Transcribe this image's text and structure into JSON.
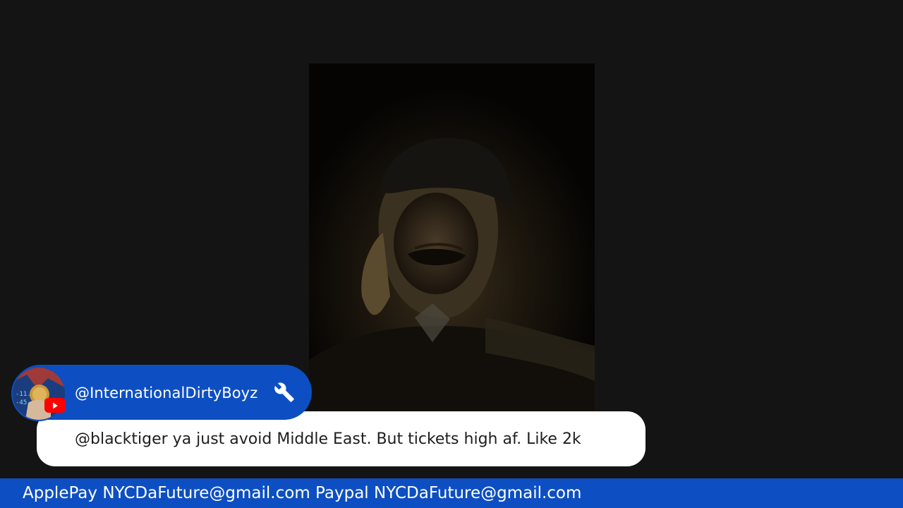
{
  "chat_highlight": {
    "author": "@InternationalDirtyBoyz",
    "author_badge_icon": "wrench-icon",
    "avatar_platform_badge": "youtube-icon",
    "message": "@blacktiger ya just avoid Middle East. But tickets high af. Like 2k"
  },
  "banner": {
    "text": "ApplePay NYCDaFuture@gmail.com Paypal NYCDaFuture@gmail.com"
  },
  "colors": {
    "background": "#141414",
    "accent_blue": "#0d4fc2",
    "message_card": "#ffffff",
    "youtube_red": "#ff0000"
  }
}
